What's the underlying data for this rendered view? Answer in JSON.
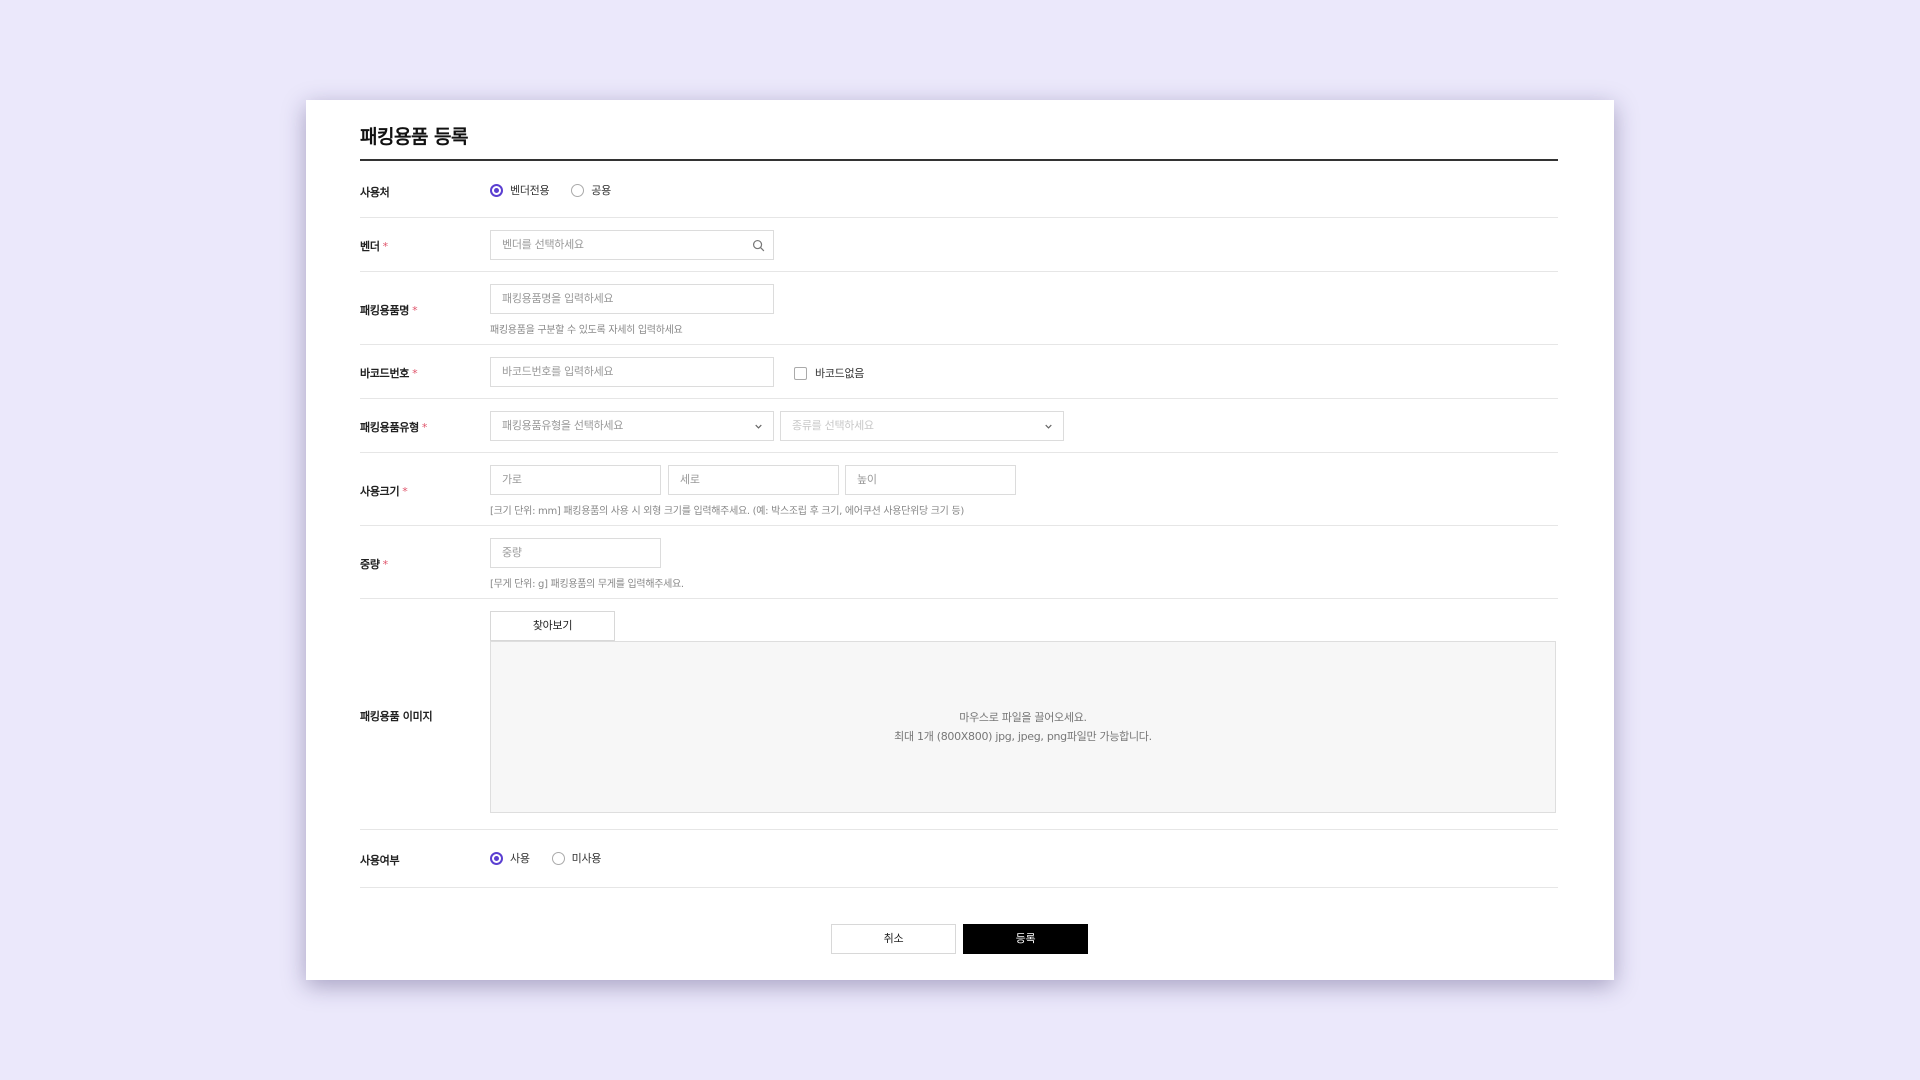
{
  "dialog": {
    "title": "패킹용품 등록"
  },
  "usage_place": {
    "label": "사용처",
    "options": [
      {
        "label": "벤더전용",
        "selected": true
      },
      {
        "label": "공용",
        "selected": false
      }
    ]
  },
  "vendor": {
    "label": "벤더",
    "required_mark": "*",
    "placeholder": "벤더를 선택하세요"
  },
  "item_name": {
    "label": "패킹용품명",
    "required_mark": "*",
    "placeholder": "패킹용품명을 입력하세요",
    "hint": "패킹용품을 구분할 수 있도록 자세히 입력하세요"
  },
  "barcode": {
    "label": "바코드번호",
    "required_mark": "*",
    "placeholder": "바코드번호를 입력하세요",
    "no_barcode_label": "바코드없음",
    "no_barcode_checked": false
  },
  "item_type": {
    "label": "패킹용품유형",
    "required_mark": "*",
    "type_placeholder": "패킹용품유형을 선택하세요",
    "kind_placeholder": "종류를 선택하세요"
  },
  "size": {
    "label": "사용크기",
    "required_mark": "*",
    "width_placeholder": "가로",
    "length_placeholder": "세로",
    "height_placeholder": "높이",
    "hint": "[크기 단위: mm] 패킹용품의 사용 시 외형 크기를 입력해주세요. (예: 박스조립 후 크기, 에어쿠션 사용단위당 크기 등)"
  },
  "weight": {
    "label": "중량",
    "required_mark": "*",
    "placeholder": "중량",
    "hint": "[무게 단위: g] 패킹용품의 무게를 입력해주세요."
  },
  "image": {
    "label": "패킹용품 이미지",
    "browse_label": "찾아보기",
    "drop_line1": "마우스로 파일을 끌어오세요.",
    "drop_line2": "최대 1개 (800X800) jpg, jpeg, png파일만 가능합니다."
  },
  "use_status": {
    "label": "사용여부",
    "options": [
      {
        "label": "사용",
        "selected": true
      },
      {
        "label": "미사용",
        "selected": false
      }
    ]
  },
  "actions": {
    "cancel_label": "취소",
    "submit_label": "등록"
  },
  "colors": {
    "accent": "#5b3fd1",
    "required": "#e0546b",
    "background": "#ebe8fb",
    "primary_button": "#000000"
  },
  "icons": {
    "search": "search-icon",
    "dropdown": "chevron-down-icon"
  }
}
